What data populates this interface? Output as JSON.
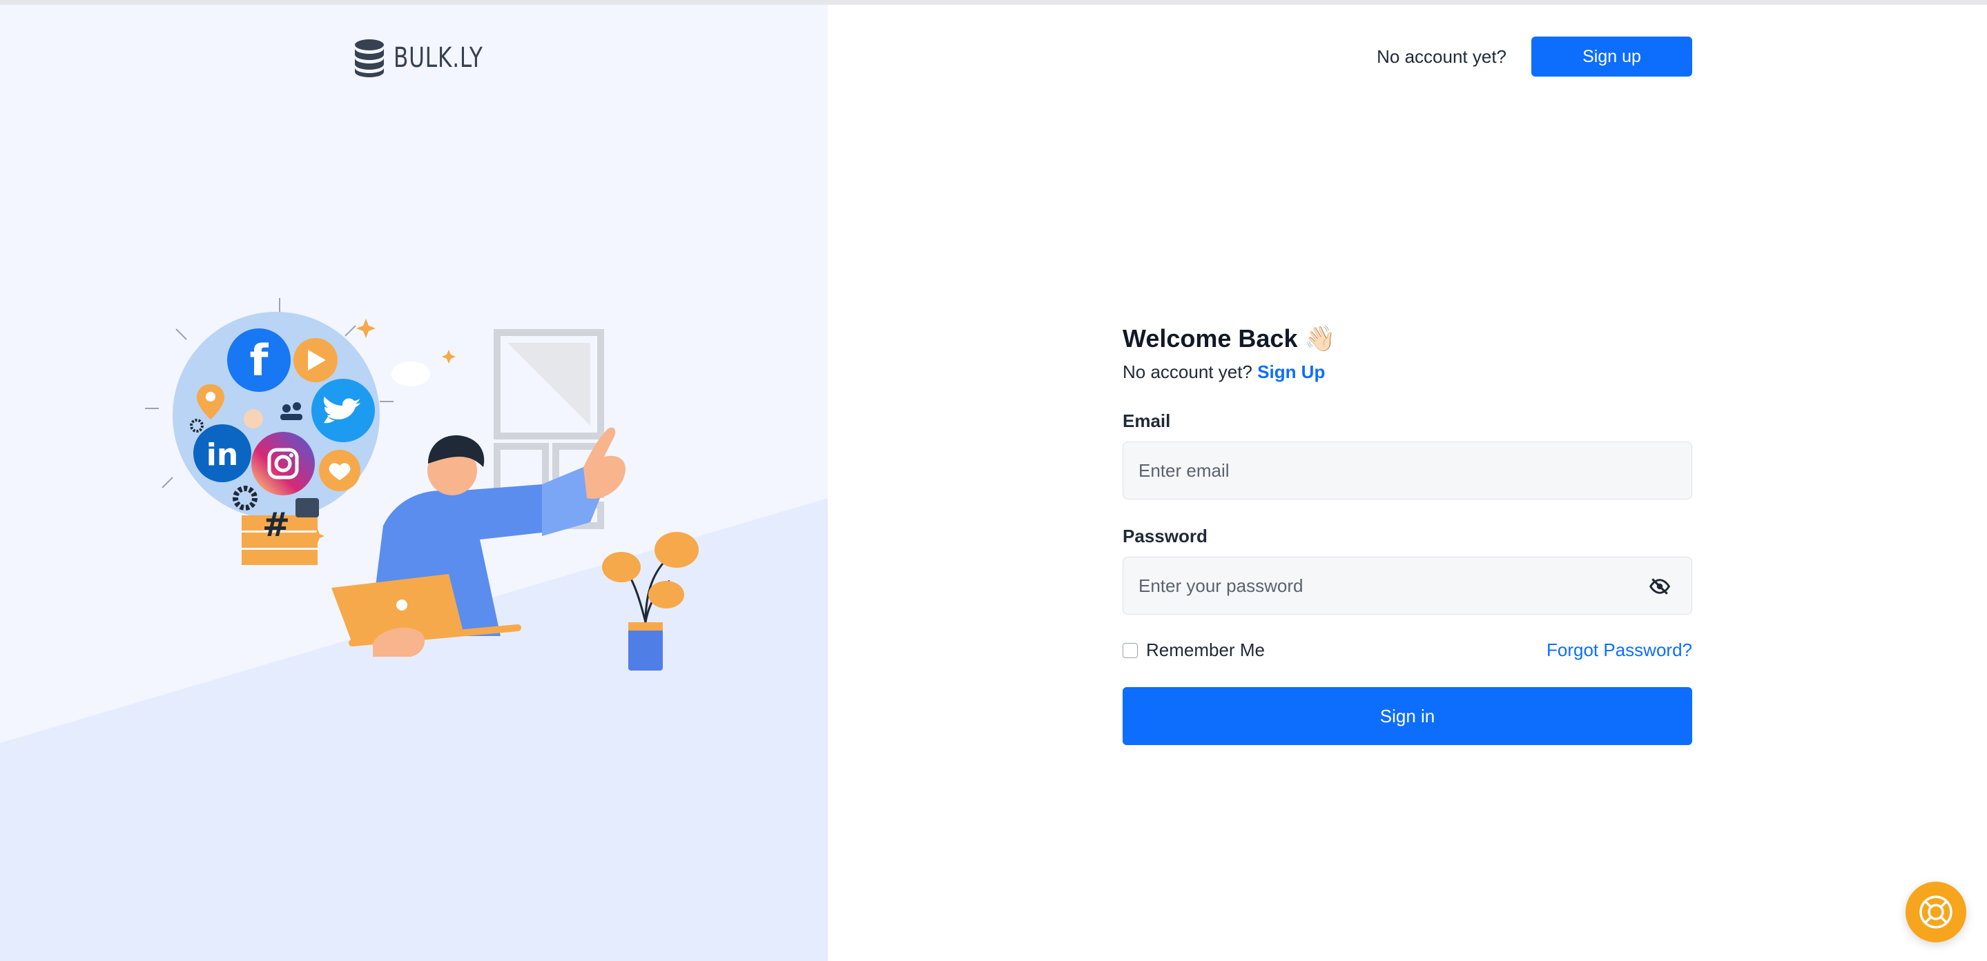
{
  "brand": {
    "name": "BULK.LY",
    "logo_icon": "database-stack-icon"
  },
  "header": {
    "note": "No account yet?",
    "signup_label": "Sign up"
  },
  "form": {
    "title": "Welcome Back",
    "title_emoji": "👋🏻",
    "subtitle_text": "No account yet?",
    "subtitle_link": "Sign Up",
    "email_label": "Email",
    "email_placeholder": "Enter email",
    "email_value": "",
    "password_label": "Password",
    "password_placeholder": "Enter your password",
    "password_value": "",
    "password_toggle_icon": "eye-slash-icon",
    "remember_label": "Remember Me",
    "remember_checked": false,
    "forgot_label": "Forgot Password?",
    "signin_label": "Sign in"
  },
  "help": {
    "icon": "lifebuoy-icon"
  },
  "colors": {
    "primary": "#0d6efd",
    "left_panel_bg": "#f3f6fe",
    "left_panel_slant": "#e5ecfd",
    "help_button": "#f6a51d"
  }
}
